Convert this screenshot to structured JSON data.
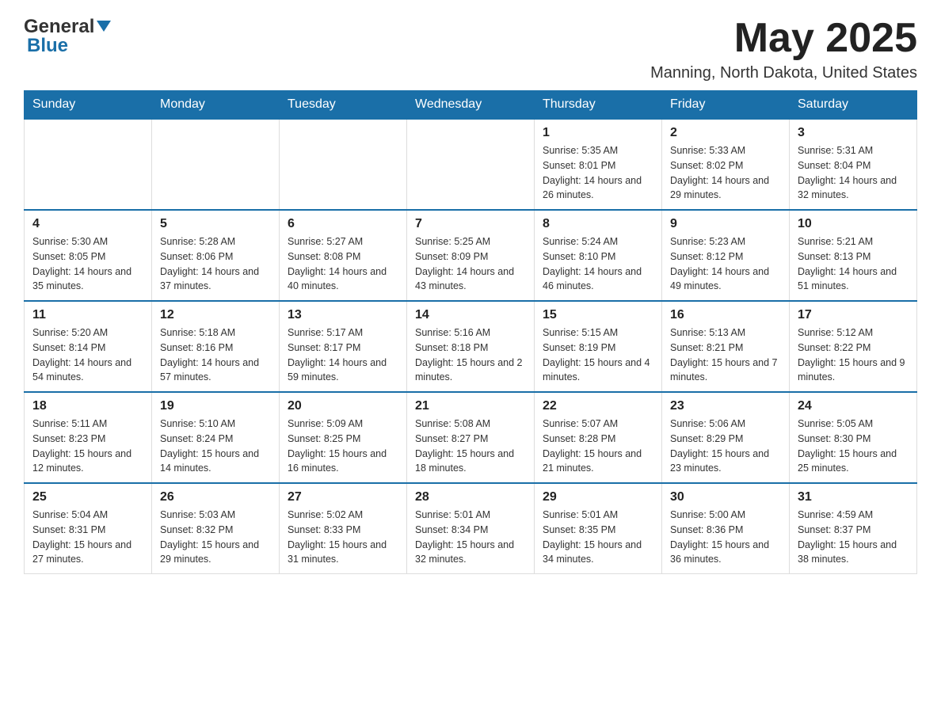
{
  "logo": {
    "general": "General",
    "blue": "Blue"
  },
  "header": {
    "month": "May 2025",
    "location": "Manning, North Dakota, United States"
  },
  "weekdays": [
    "Sunday",
    "Monday",
    "Tuesday",
    "Wednesday",
    "Thursday",
    "Friday",
    "Saturday"
  ],
  "weeks": [
    [
      {
        "day": "",
        "info": ""
      },
      {
        "day": "",
        "info": ""
      },
      {
        "day": "",
        "info": ""
      },
      {
        "day": "",
        "info": ""
      },
      {
        "day": "1",
        "info": "Sunrise: 5:35 AM\nSunset: 8:01 PM\nDaylight: 14 hours and 26 minutes."
      },
      {
        "day": "2",
        "info": "Sunrise: 5:33 AM\nSunset: 8:02 PM\nDaylight: 14 hours and 29 minutes."
      },
      {
        "day": "3",
        "info": "Sunrise: 5:31 AM\nSunset: 8:04 PM\nDaylight: 14 hours and 32 minutes."
      }
    ],
    [
      {
        "day": "4",
        "info": "Sunrise: 5:30 AM\nSunset: 8:05 PM\nDaylight: 14 hours and 35 minutes."
      },
      {
        "day": "5",
        "info": "Sunrise: 5:28 AM\nSunset: 8:06 PM\nDaylight: 14 hours and 37 minutes."
      },
      {
        "day": "6",
        "info": "Sunrise: 5:27 AM\nSunset: 8:08 PM\nDaylight: 14 hours and 40 minutes."
      },
      {
        "day": "7",
        "info": "Sunrise: 5:25 AM\nSunset: 8:09 PM\nDaylight: 14 hours and 43 minutes."
      },
      {
        "day": "8",
        "info": "Sunrise: 5:24 AM\nSunset: 8:10 PM\nDaylight: 14 hours and 46 minutes."
      },
      {
        "day": "9",
        "info": "Sunrise: 5:23 AM\nSunset: 8:12 PM\nDaylight: 14 hours and 49 minutes."
      },
      {
        "day": "10",
        "info": "Sunrise: 5:21 AM\nSunset: 8:13 PM\nDaylight: 14 hours and 51 minutes."
      }
    ],
    [
      {
        "day": "11",
        "info": "Sunrise: 5:20 AM\nSunset: 8:14 PM\nDaylight: 14 hours and 54 minutes."
      },
      {
        "day": "12",
        "info": "Sunrise: 5:18 AM\nSunset: 8:16 PM\nDaylight: 14 hours and 57 minutes."
      },
      {
        "day": "13",
        "info": "Sunrise: 5:17 AM\nSunset: 8:17 PM\nDaylight: 14 hours and 59 minutes."
      },
      {
        "day": "14",
        "info": "Sunrise: 5:16 AM\nSunset: 8:18 PM\nDaylight: 15 hours and 2 minutes."
      },
      {
        "day": "15",
        "info": "Sunrise: 5:15 AM\nSunset: 8:19 PM\nDaylight: 15 hours and 4 minutes."
      },
      {
        "day": "16",
        "info": "Sunrise: 5:13 AM\nSunset: 8:21 PM\nDaylight: 15 hours and 7 minutes."
      },
      {
        "day": "17",
        "info": "Sunrise: 5:12 AM\nSunset: 8:22 PM\nDaylight: 15 hours and 9 minutes."
      }
    ],
    [
      {
        "day": "18",
        "info": "Sunrise: 5:11 AM\nSunset: 8:23 PM\nDaylight: 15 hours and 12 minutes."
      },
      {
        "day": "19",
        "info": "Sunrise: 5:10 AM\nSunset: 8:24 PM\nDaylight: 15 hours and 14 minutes."
      },
      {
        "day": "20",
        "info": "Sunrise: 5:09 AM\nSunset: 8:25 PM\nDaylight: 15 hours and 16 minutes."
      },
      {
        "day": "21",
        "info": "Sunrise: 5:08 AM\nSunset: 8:27 PM\nDaylight: 15 hours and 18 minutes."
      },
      {
        "day": "22",
        "info": "Sunrise: 5:07 AM\nSunset: 8:28 PM\nDaylight: 15 hours and 21 minutes."
      },
      {
        "day": "23",
        "info": "Sunrise: 5:06 AM\nSunset: 8:29 PM\nDaylight: 15 hours and 23 minutes."
      },
      {
        "day": "24",
        "info": "Sunrise: 5:05 AM\nSunset: 8:30 PM\nDaylight: 15 hours and 25 minutes."
      }
    ],
    [
      {
        "day": "25",
        "info": "Sunrise: 5:04 AM\nSunset: 8:31 PM\nDaylight: 15 hours and 27 minutes."
      },
      {
        "day": "26",
        "info": "Sunrise: 5:03 AM\nSunset: 8:32 PM\nDaylight: 15 hours and 29 minutes."
      },
      {
        "day": "27",
        "info": "Sunrise: 5:02 AM\nSunset: 8:33 PM\nDaylight: 15 hours and 31 minutes."
      },
      {
        "day": "28",
        "info": "Sunrise: 5:01 AM\nSunset: 8:34 PM\nDaylight: 15 hours and 32 minutes."
      },
      {
        "day": "29",
        "info": "Sunrise: 5:01 AM\nSunset: 8:35 PM\nDaylight: 15 hours and 34 minutes."
      },
      {
        "day": "30",
        "info": "Sunrise: 5:00 AM\nSunset: 8:36 PM\nDaylight: 15 hours and 36 minutes."
      },
      {
        "day": "31",
        "info": "Sunrise: 4:59 AM\nSunset: 8:37 PM\nDaylight: 15 hours and 38 minutes."
      }
    ]
  ]
}
